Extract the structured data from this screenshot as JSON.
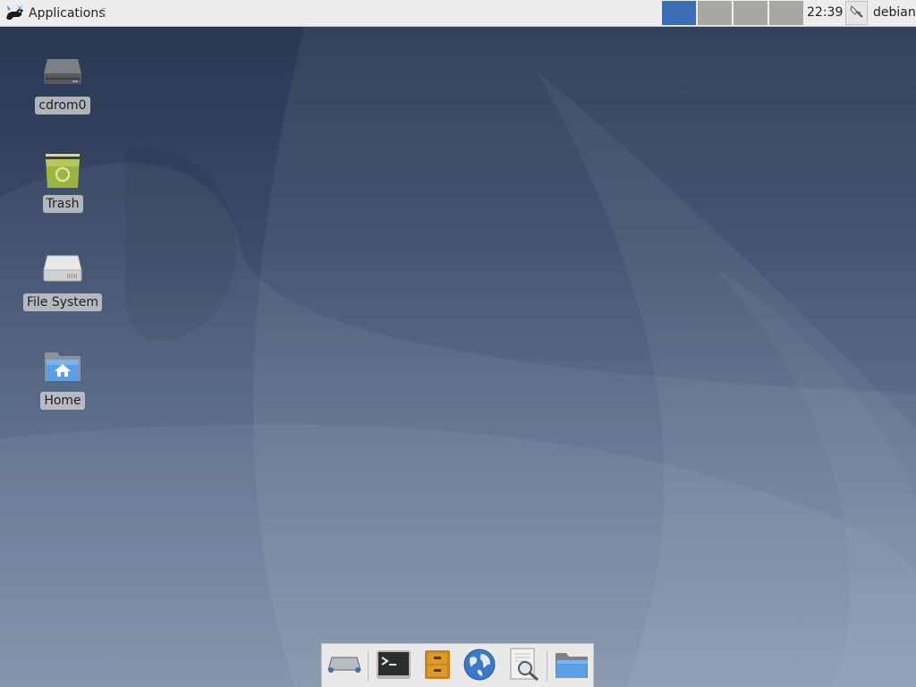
{
  "top_panel": {
    "applications_label": "Applications",
    "workspaces": [
      {
        "name": "workspace-1",
        "active": true
      },
      {
        "name": "workspace-2",
        "active": false
      },
      {
        "name": "workspace-3",
        "active": false
      },
      {
        "name": "workspace-4",
        "active": false
      }
    ],
    "clock": "22:39",
    "tray_icon": "network-cable-icon",
    "user": "debian"
  },
  "desktop_icons": [
    {
      "label": "cdrom0",
      "icon": "optical-drive-icon"
    },
    {
      "label": "Trash",
      "icon": "trash-icon"
    },
    {
      "label": "File System",
      "icon": "hard-drive-icon"
    },
    {
      "label": "Home",
      "icon": "home-folder-icon"
    }
  ],
  "dock": {
    "items": [
      {
        "name": "show-desktop",
        "icon": "show-desktop-icon"
      },
      {
        "name": "terminal",
        "icon": "terminal-icon"
      },
      {
        "name": "file-manager",
        "icon": "file-cabinet-icon"
      },
      {
        "name": "web-browser",
        "icon": "globe-icon"
      },
      {
        "name": "app-finder",
        "icon": "search-document-icon"
      },
      {
        "name": "folder",
        "icon": "folder-icon"
      }
    ]
  },
  "colors": {
    "panel_bg": "#ededed",
    "workspace_active": "#3d6db5",
    "workspace_inactive": "#a9a7a1",
    "desktop_top": "#26344f",
    "desktop_bottom": "#7a8aa4"
  }
}
